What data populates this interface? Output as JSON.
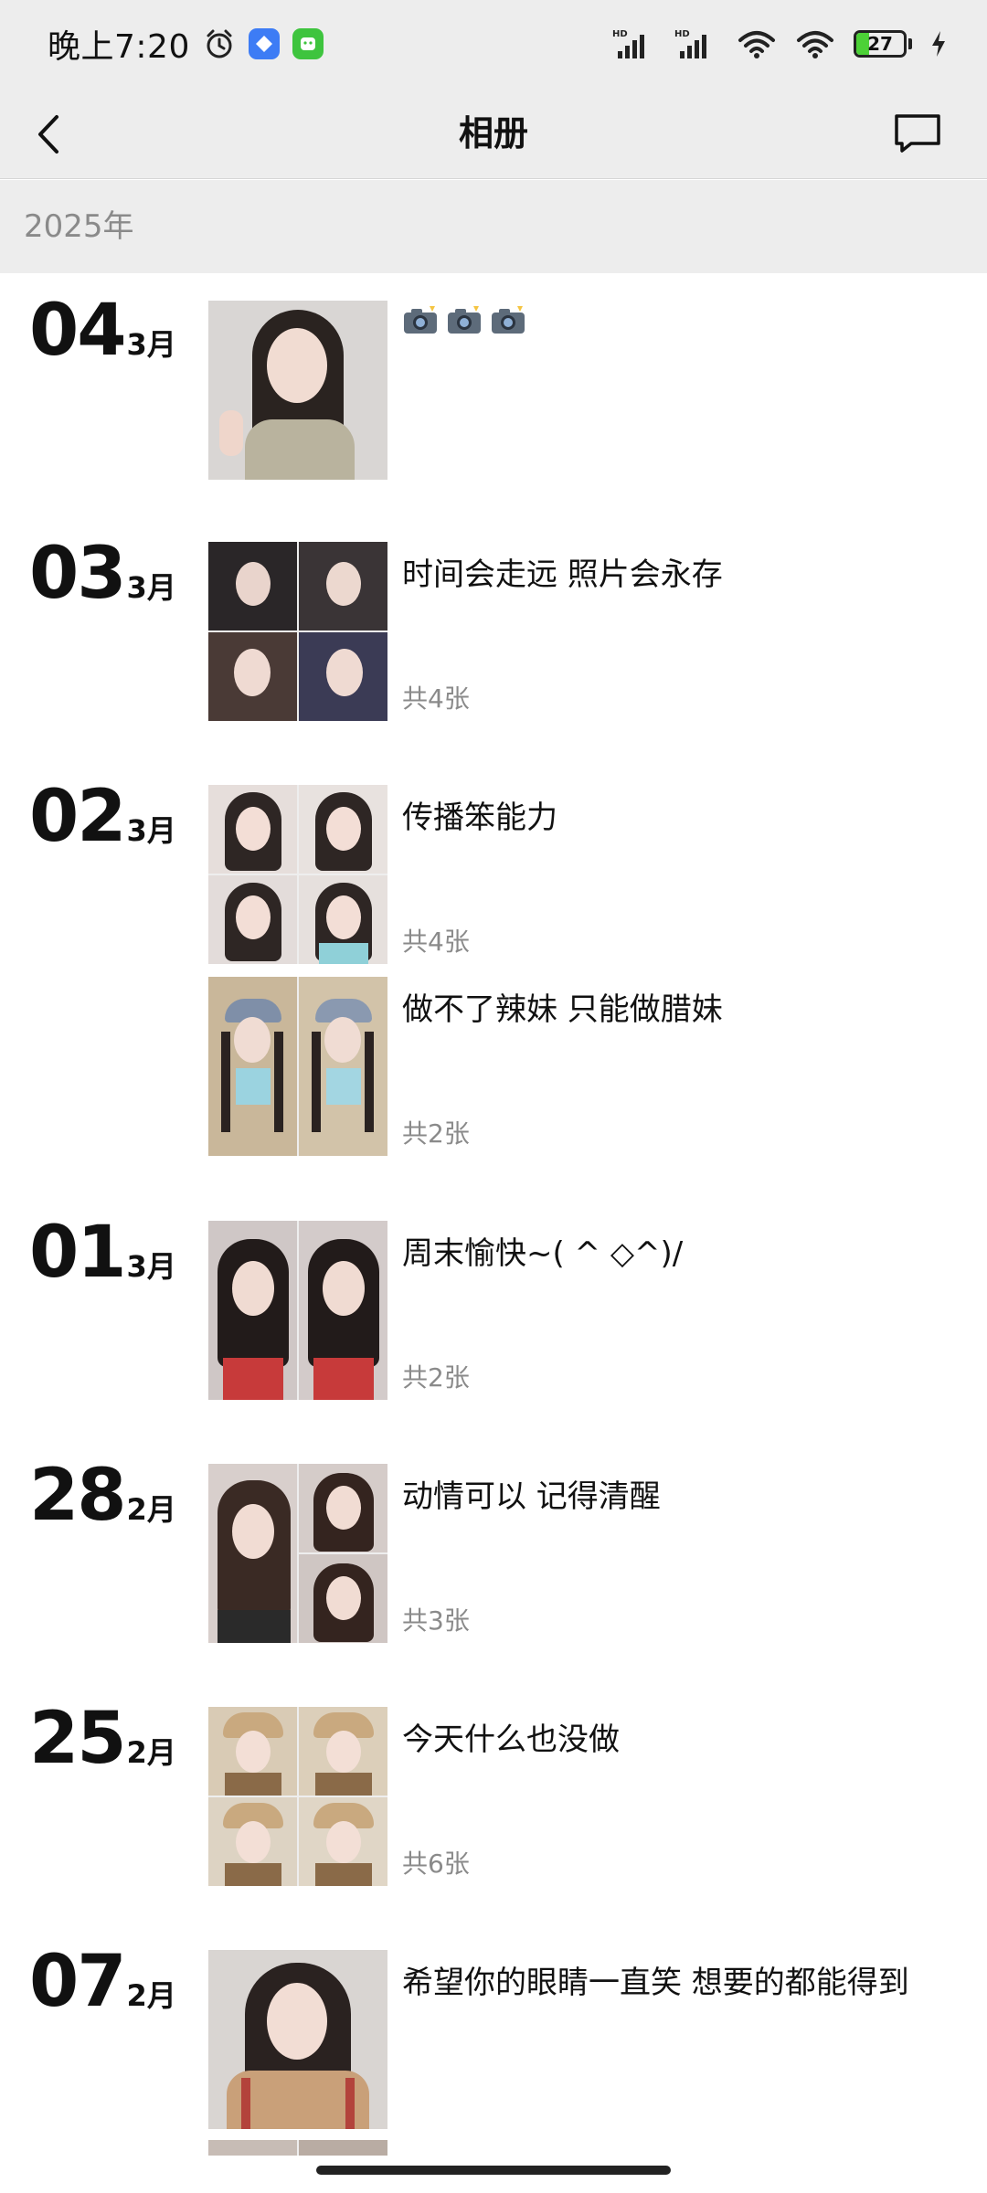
{
  "status_bar": {
    "time": "晚上7:20",
    "battery": "27",
    "battery_level": 0.27
  },
  "navbar": {
    "title": "相册"
  },
  "year": "2025年",
  "feed": [
    {
      "day": "04",
      "month": "3月",
      "entries": [
        {
          "caption": "📸📸📸",
          "count": "",
          "photos": 1
        }
      ]
    },
    {
      "day": "03",
      "month": "3月",
      "entries": [
        {
          "caption": "时间会走远  照片会永存",
          "count": "共4张",
          "photos": 4
        }
      ]
    },
    {
      "day": "02",
      "month": "3月",
      "entries": [
        {
          "caption": "传播笨能力",
          "count": "共4张",
          "photos": 4
        },
        {
          "caption": "做不了辣妹  只能做腊妹",
          "count": "共2张",
          "photos": 2
        }
      ]
    },
    {
      "day": "01",
      "month": "3月",
      "entries": [
        {
          "caption": "周末愉快~( ^ ◇^)/",
          "count": "共2张",
          "photos": 2
        }
      ]
    },
    {
      "day": "28",
      "month": "2月",
      "entries": [
        {
          "caption": "动情可以   记得清醒",
          "count": "共3张",
          "photos": 3
        }
      ]
    },
    {
      "day": "25",
      "month": "2月",
      "entries": [
        {
          "caption": "今天什么也没做",
          "count": "共6张",
          "photos": 4
        }
      ]
    },
    {
      "day": "07",
      "month": "2月",
      "entries": [
        {
          "caption": "希望你的眼睛一直笑 想要的都能得到",
          "count": "",
          "photos": 1
        }
      ]
    }
  ],
  "icons": {
    "back": "chevron-left-icon",
    "message": "message-icon",
    "alarm": "alarm-icon",
    "wifi": "wifi-icon",
    "signal": "signal-icon",
    "charging": "bolt-icon"
  }
}
